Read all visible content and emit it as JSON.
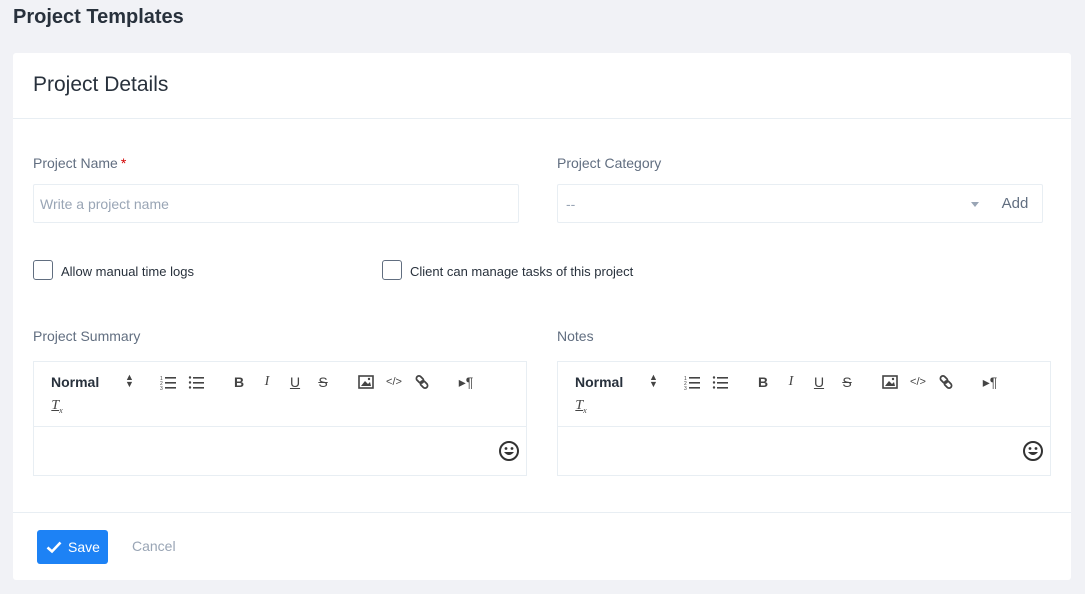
{
  "page": {
    "title": "Project Templates"
  },
  "card": {
    "title": "Project Details"
  },
  "form": {
    "project_name": {
      "label": "Project Name",
      "required_mark": "*",
      "placeholder": "Write a project name",
      "value": ""
    },
    "project_category": {
      "label": "Project Category",
      "selected": "--",
      "add_label": "Add"
    },
    "manual_time_logs": {
      "label": "Allow manual time logs",
      "checked": false
    },
    "client_manage_tasks": {
      "label": "Client can manage tasks of this project",
      "checked": false
    },
    "project_summary": {
      "label": "Project Summary",
      "format": "Normal"
    },
    "notes": {
      "label": "Notes",
      "format": "Normal"
    }
  },
  "toolbar_icons": [
    "ordered-list-icon",
    "bullet-list-icon",
    "bold-icon",
    "italic-icon",
    "underline-icon",
    "strikethrough-icon",
    "image-icon",
    "code-icon",
    "link-icon",
    "text-direction-icon",
    "clear-format-icon"
  ],
  "footer": {
    "save_label": "Save",
    "cancel_label": "Cancel"
  },
  "colors": {
    "primary": "#1d82f5",
    "background": "#f1f2f6",
    "border": "#e8eef3",
    "required": "#d30000"
  }
}
